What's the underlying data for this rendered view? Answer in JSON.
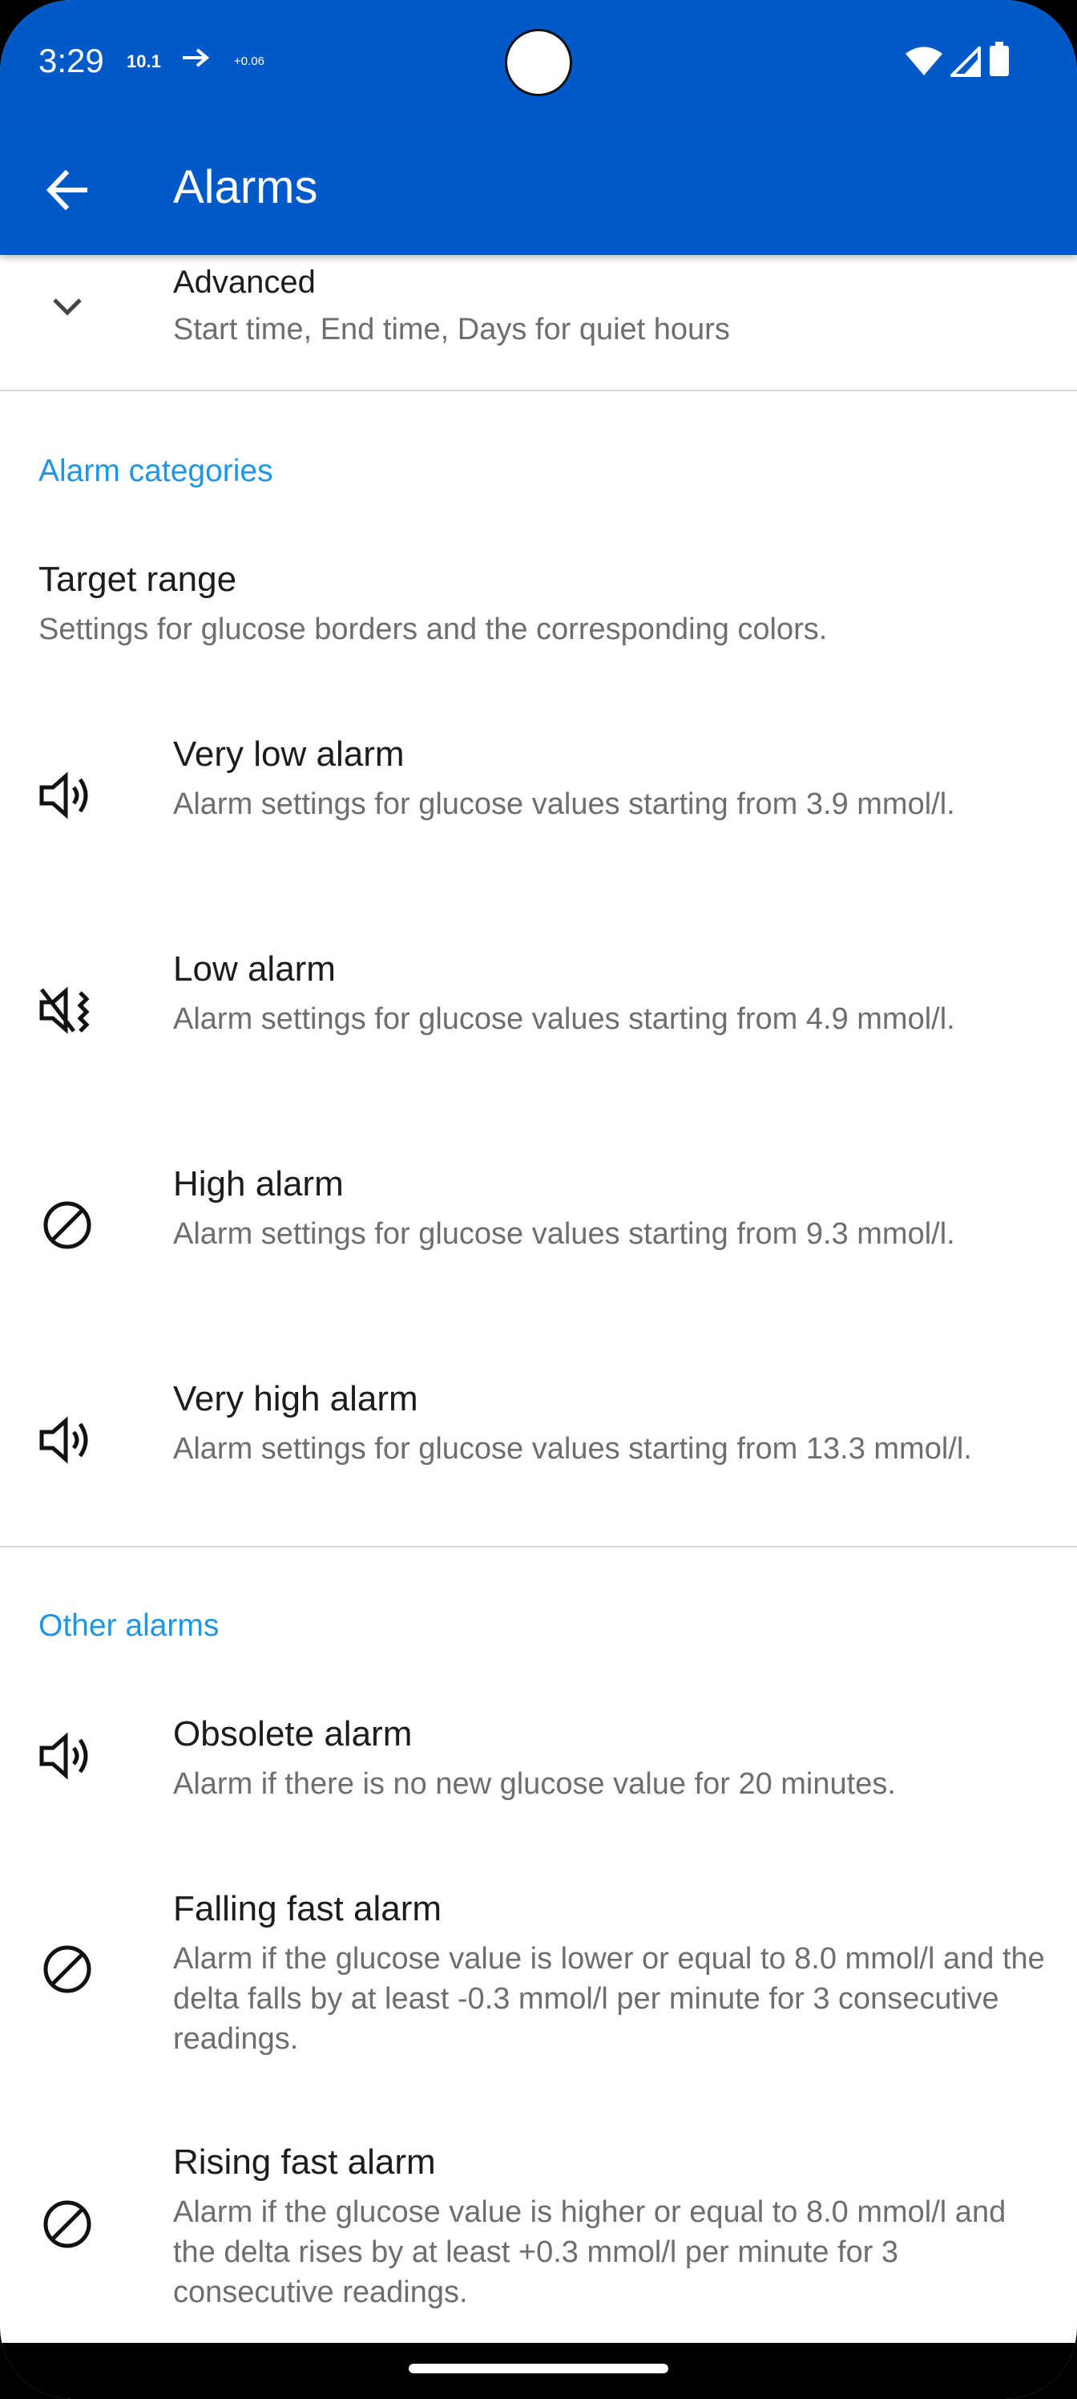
{
  "status_bar": {
    "time": "3:29",
    "small_text": "10.1",
    "arrow": "→",
    "tiny_text": "+0.06",
    "icons": [
      "wifi-icon",
      "signal-icon",
      "battery-icon"
    ]
  },
  "app_bar": {
    "title": "Alarms",
    "back_icon": "arrow-back-icon",
    "color": "#0059c8"
  },
  "advanced": {
    "icon": "chevron-down-icon",
    "title": "Advanced",
    "summary": "Start time, End time, Days for quiet hours"
  },
  "alarm_categories": {
    "header": "Alarm categories",
    "items": [
      {
        "title": "Target range",
        "summary": "Settings for glucose borders and the corresponding colors.",
        "icon": ""
      },
      {
        "title": "Very low alarm",
        "summary": "Alarm settings for glucose values starting from 3.9 mmol/l.",
        "icon": "volume-up-icon"
      },
      {
        "title": "Low alarm",
        "summary": "Alarm settings for glucose values starting from 4.9 mmol/l.",
        "icon": "vibrate-muted-icon"
      },
      {
        "title": "High alarm",
        "summary": "Alarm settings for glucose values starting from 9.3 mmol/l.",
        "icon": "disabled-icon"
      },
      {
        "title": "Very high alarm",
        "summary": "Alarm settings for glucose values starting from 13.3 mmol/l.",
        "icon": "volume-up-icon"
      }
    ]
  },
  "other_alarms": {
    "header": "Other alarms",
    "items": [
      {
        "title": "Obsolete alarm",
        "summary": "Alarm if there is no new glucose value for 20 minutes.",
        "icon": "volume-up-icon"
      },
      {
        "title": "Falling fast alarm",
        "summary": "Alarm if the glucose value is lower or equal to 8.0 mmol/l and the delta falls by at least -0.3 mmol/l per minute for 3 consecutive readings.",
        "icon": "disabled-icon"
      },
      {
        "title": "Rising fast alarm",
        "summary": "Alarm if the glucose value is higher or equal to 8.0 mmol/l and the delta rises by at least +0.3 mmol/l per minute for 3 consecutive readings.",
        "icon": "disabled-icon"
      }
    ]
  },
  "colors": {
    "accent": "#1e96e8",
    "primary": "#0059c8"
  }
}
